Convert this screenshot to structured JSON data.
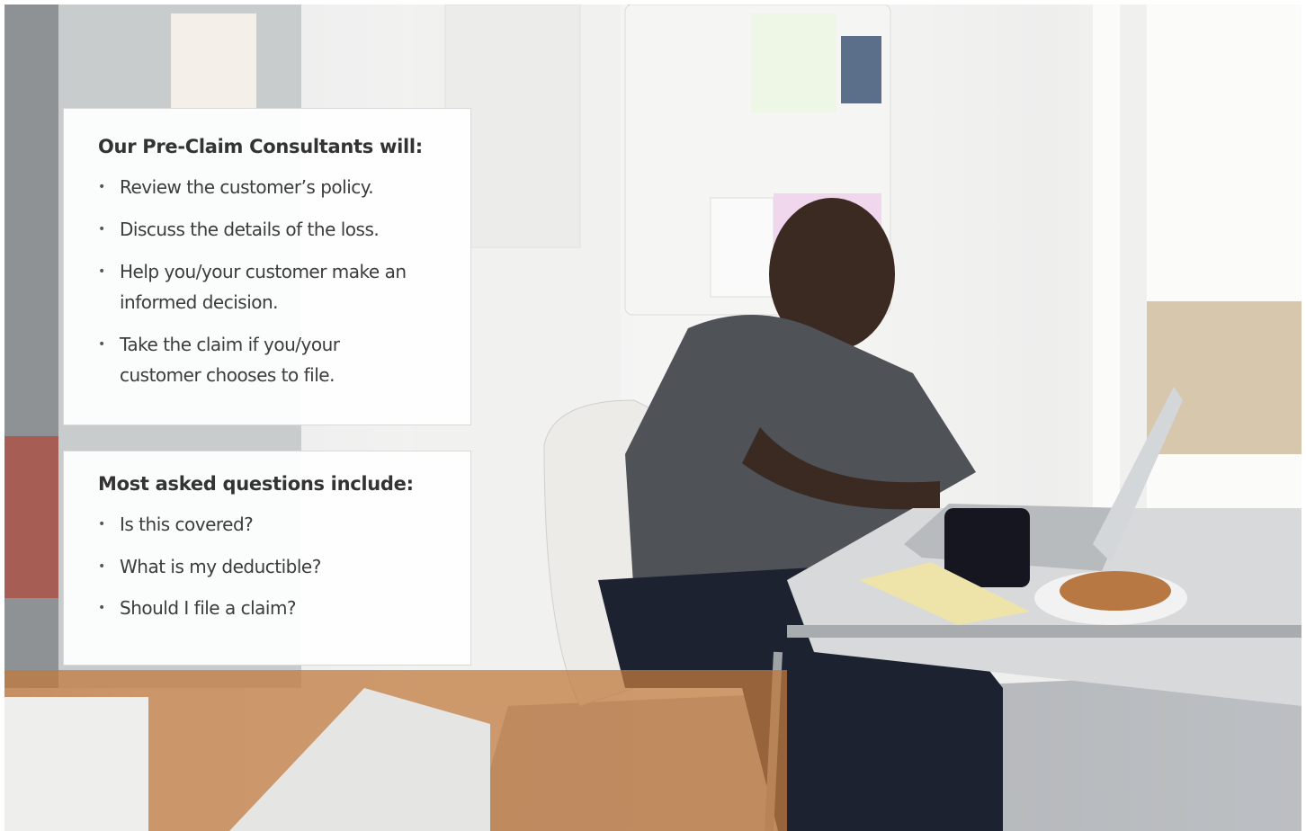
{
  "consultants": {
    "heading": "Our Pre-Claim Consultants will:",
    "items": [
      "Review the customer’s policy.",
      "Discuss the details of the loss.",
      "Help you/your customer make an informed decision.",
      "Take the claim if you/your customer chooses to file."
    ]
  },
  "questions": {
    "heading": "Most asked questions include:",
    "items": [
      "Is this covered?",
      "What is my deductible?",
      "Should I file a claim?"
    ]
  }
}
